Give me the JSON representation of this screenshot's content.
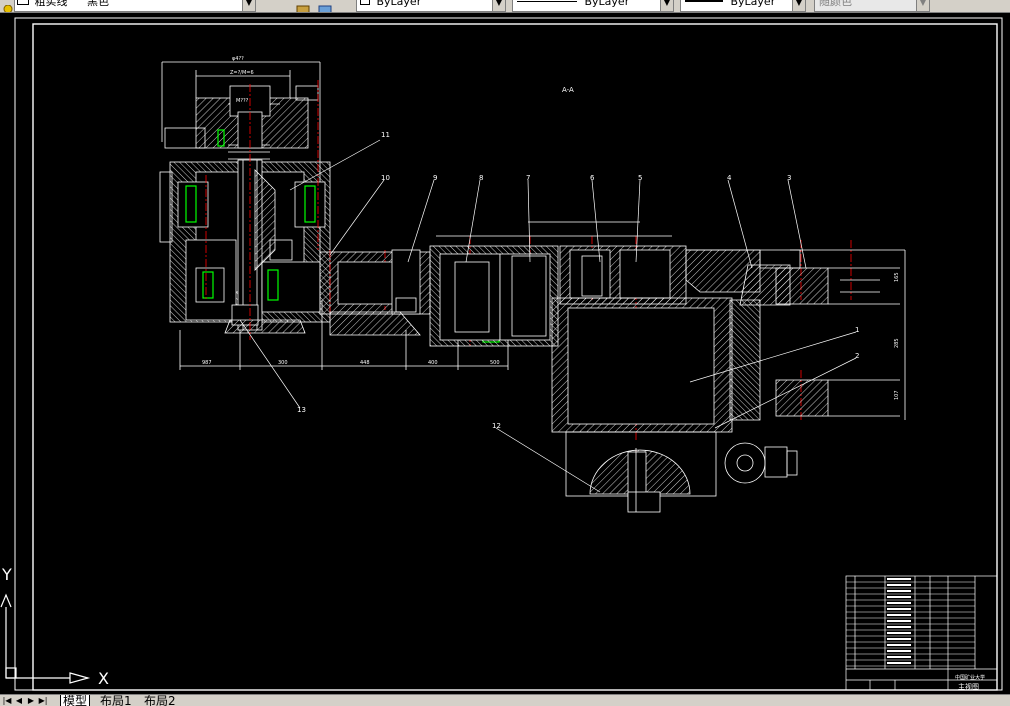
{
  "toolbar": {
    "linetype_label": "粗实线",
    "color_label": "黑色",
    "layer_value": "ByLayer",
    "linetype_value": "ByLayer",
    "lineweight_value": "ByLayer",
    "plotstyle_value": "随颜色"
  },
  "drawing": {
    "section_label": "A-A",
    "leader_labels": [
      "11",
      "10",
      "9",
      "8",
      "7",
      "6",
      "5",
      "4",
      "3",
      "1",
      "2",
      "12",
      "13"
    ],
    "dim_top_1": "φ4??",
    "dim_top_2": "Z=?/M=6",
    "dim_small": "M???",
    "dim_bottom": [
      "987",
      "300",
      "448",
      "400",
      "500"
    ],
    "dim_side": [
      "165",
      "285",
      "107"
    ]
  },
  "title_block": {
    "school": "中国矿业大学",
    "drawing_name": "主视图"
  },
  "ucs": {
    "x_label": "X",
    "y_label": "Y"
  },
  "tabs": [
    {
      "label": "模型",
      "active": true
    },
    {
      "label": "布局1",
      "active": false
    },
    {
      "label": "布局2",
      "active": false
    }
  ],
  "colors": {
    "background": "#000000",
    "line": "#ffffff",
    "centerline": "#ff0000",
    "hatch": "#ffffff",
    "bearing": "#00ff00"
  }
}
